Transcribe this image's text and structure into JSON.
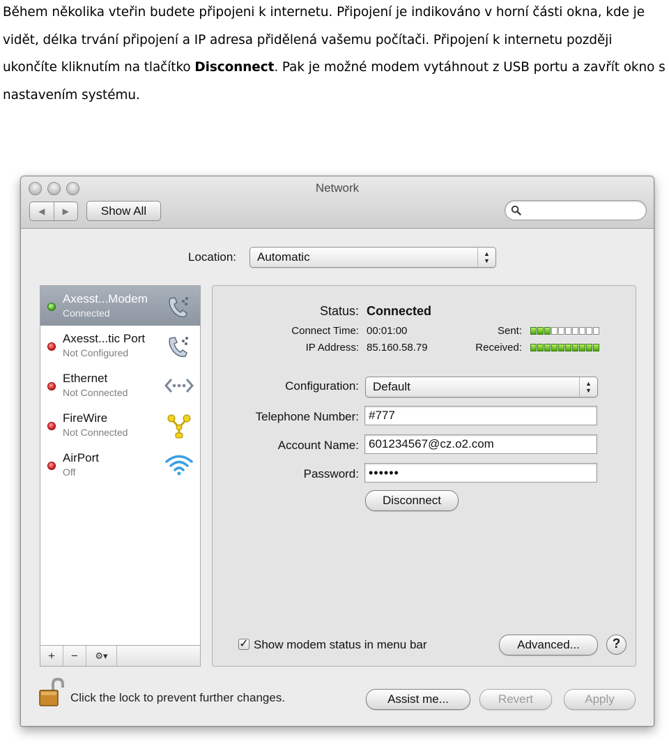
{
  "document": {
    "paragraph_before": "Během několika vteřin budete připojeni k internetu. Připojení je indikováno v horní části okna, kde je vidět, délka trvání připojení a IP adresa přidělená vašemu počítači. Připojení k internetu později ukončíte kliknutím na tlačítko ",
    "paragraph_bold": "Disconnect",
    "paragraph_after": ". Pak je možné modem vytáhnout z USB portu a zavřít okno s nastavením systému."
  },
  "window": {
    "title": "Network",
    "show_all_label": "Show All",
    "search_placeholder": ""
  },
  "location": {
    "label": "Location:",
    "value": "Automatic"
  },
  "services": [
    {
      "name": "Axesst...Modem",
      "state": "Connected",
      "status_color": "green",
      "icon": "telephone-modem-icon",
      "selected": true
    },
    {
      "name": "Axesst...tic Port",
      "state": "Not Configured",
      "status_color": "red",
      "icon": "telephone-modem-icon",
      "selected": false
    },
    {
      "name": "Ethernet",
      "state": "Not Connected",
      "status_color": "red",
      "icon": "ethernet-icon",
      "selected": false
    },
    {
      "name": "FireWire",
      "state": "Not Connected",
      "status_color": "red",
      "icon": "firewire-icon",
      "selected": false
    },
    {
      "name": "AirPort",
      "state": "Off",
      "status_color": "red",
      "icon": "wifi-icon",
      "selected": false
    }
  ],
  "sidebar_buttons": {
    "add": "+",
    "remove": "−",
    "gear": "⚙▾"
  },
  "detail": {
    "status_label": "Status:",
    "status_value": "Connected",
    "connect_time_label": "Connect Time:",
    "connect_time_value": "00:01:00",
    "ip_label": "IP Address:",
    "ip_value": "85.160.58.79",
    "sent_label": "Sent:",
    "received_label": "Received:",
    "sent_level": 0.3,
    "received_level": 1.0,
    "configuration_label": "Configuration:",
    "configuration_value": "Default",
    "telephone_label": "Telephone Number:",
    "telephone_value": "#777",
    "account_label": "Account Name:",
    "account_value": "601234567@cz.o2.com",
    "password_label": "Password:",
    "password_value": "••••••",
    "disconnect_label": "Disconnect",
    "show_modem_status_label": "Show modem status in menu bar",
    "show_modem_status_checked": true,
    "advanced_label": "Advanced...",
    "help_label": "?"
  },
  "footer": {
    "lock_text": "Click the lock to prevent further changes.",
    "assist_label": "Assist me...",
    "revert_label": "Revert",
    "apply_label": "Apply"
  },
  "colors": {
    "selected_row": "#9aa2ad",
    "status_green": "#3ca31a",
    "status_red": "#c9161a",
    "meter_green": "#4aa50f"
  }
}
